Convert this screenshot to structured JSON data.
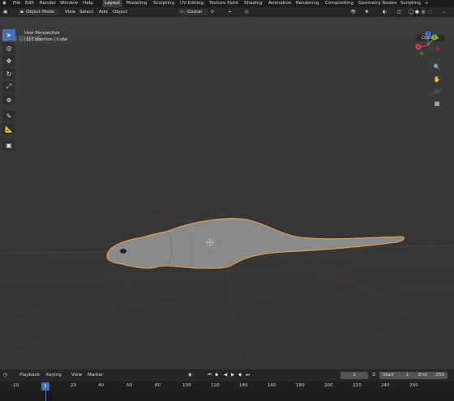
{
  "topbar": {
    "menus": [
      "File",
      "Edit",
      "Render",
      "Window",
      "Help"
    ],
    "workspaces": [
      "Layout",
      "Modeling",
      "Sculpting",
      "UV Editing",
      "Texture Paint",
      "Shading",
      "Animation",
      "Rendering",
      "Compositing",
      "Geometry Nodes",
      "Scripting"
    ],
    "active_workspace": "Layout",
    "add_tab": "+"
  },
  "header": {
    "mode": "Object Mode",
    "menus": [
      "View",
      "Select",
      "Add",
      "Object"
    ],
    "orientation": "Global",
    "options": "Options"
  },
  "viewport": {
    "perspective": "User Perspective",
    "collection": "(1) Collection | Cube"
  },
  "gizmo": {
    "x": "X",
    "y": "Y",
    "z": "Z"
  },
  "timeline": {
    "menus": [
      "Playback",
      "Keying",
      "View",
      "Marker"
    ],
    "current_frame": "1",
    "start_label": "Start",
    "start": "1",
    "end_label": "End",
    "end": "250",
    "ruler_ticks": [
      "-20",
      "1",
      "20",
      "40",
      "60",
      "80",
      "100",
      "120",
      "140",
      "160",
      "180",
      "200",
      "220",
      "240",
      "260"
    ]
  },
  "colors": {
    "accent": "#4772b3",
    "selection": "#e8a040",
    "x_axis": "#e04050",
    "y_axis": "#80c020",
    "z_axis": "#4a80e0"
  }
}
